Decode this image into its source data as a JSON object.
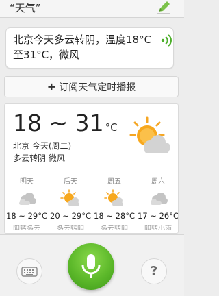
{
  "query": {
    "text": "“天气”"
  },
  "response": {
    "text": "北京今天多云转阴，温度18°C至31°C，微风"
  },
  "subscribe": {
    "plus": "+",
    "label": "订阅天气定时播报"
  },
  "today": {
    "temp_range": "18 ~ 31",
    "unit": "°C",
    "city_day": "北京 今天(周二)",
    "condition": "多云转阴 微风",
    "icon": "partly-cloudy-icon"
  },
  "forecast": [
    {
      "day": "明天",
      "icon": "cloudy-icon",
      "temp": "18 ~ 29°C",
      "desc": "阴转多云"
    },
    {
      "day": "后天",
      "icon": "partly-cloudy-icon",
      "temp": "20 ~ 29°C",
      "desc": "多云转阴"
    },
    {
      "day": "周五",
      "icon": "partly-cloudy-icon",
      "temp": "18 ~ 28°C",
      "desc": "多云转阴"
    },
    {
      "day": "周六",
      "icon": "cloudy-icon",
      "temp": "17 ~ 26°C",
      "desc": "阴转小雨"
    }
  ],
  "controls": {
    "help_label": "?"
  },
  "colors": {
    "accent_green": "#5cb82a",
    "sun_orange": "#f5a623"
  }
}
